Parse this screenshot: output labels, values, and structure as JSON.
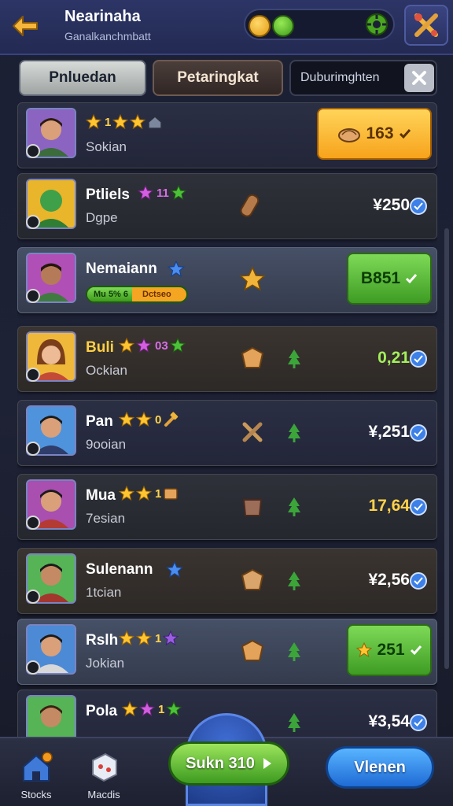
{
  "header": {
    "title": "Nearinaha",
    "subtitle": "Ganalkanchmbatt"
  },
  "tabs": {
    "tab1": "Pnluedan",
    "tab2": "Petaringkat",
    "search_value": "Duburimghten"
  },
  "rows": [
    {
      "name": "",
      "stars_text": "1",
      "sub": "Sokian",
      "price": "163"
    },
    {
      "name": "Ptliels",
      "stars_text": "11",
      "sub": "Dgpe",
      "price": "¥250"
    },
    {
      "name": "Nemaiann",
      "sub": "",
      "progress_a": "Mu 5% 6",
      "progress_b": "Dctseo",
      "progress_fraction": 0.45,
      "price": "B851"
    },
    {
      "name": "Buli",
      "stars_text": "03",
      "sub": "Ockian",
      "price": "0,21"
    },
    {
      "name": "Pan",
      "stars_text": "0",
      "sub": "9ooian",
      "price": "¥,251"
    },
    {
      "name": "Mua",
      "stars_text": "1",
      "sub": "7esian",
      "price": "17,64"
    },
    {
      "name": "Sulenann",
      "sub": "1tcian",
      "price": "¥2,56"
    },
    {
      "name": "Rslh",
      "stars_text": "1",
      "sub": "Jokian",
      "price": "251"
    },
    {
      "name": "Pola",
      "stars_text": "1",
      "sub": "",
      "price": "¥3,54"
    }
  ],
  "bottom_nav": {
    "item1": "Stocks",
    "item2": "Macdis",
    "start_label": "Sukn 310",
    "view_label": "Vlenen"
  },
  "colors": {
    "accent_green": "#3e9c24",
    "accent_orange": "#f7a31b",
    "accent_blue": "#1f6bd6"
  }
}
